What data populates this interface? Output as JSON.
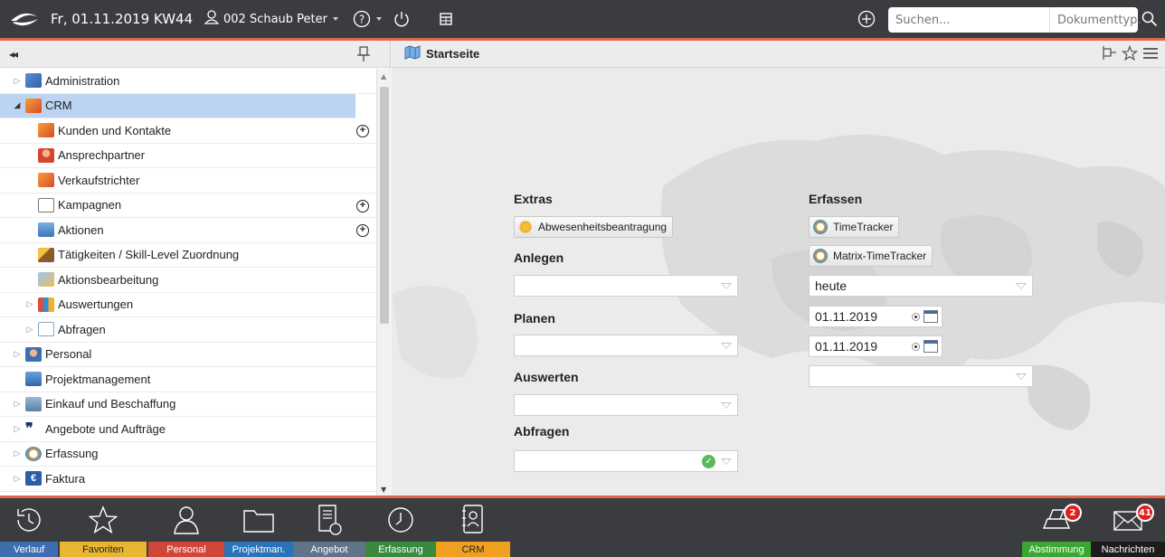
{
  "topbar": {
    "date": "Fr, 01.11.2019 KW44",
    "user": "002 Schaub Peter",
    "search_placeholder": "Suchen...",
    "doc_type": "Dokumenttyp."
  },
  "sidebar": {
    "collapse_label": "◂◂",
    "items": [
      {
        "label": "Administration",
        "icon": "wrench-icon"
      },
      {
        "label": "CRM",
        "icon": "crm-icon"
      },
      {
        "label": "Kunden und Kontakte",
        "icon": "crm-icon"
      },
      {
        "label": "Ansprechpartner",
        "icon": "person-icon"
      },
      {
        "label": "Verkaufstrichter",
        "icon": "crm-icon"
      },
      {
        "label": "Kampagnen",
        "icon": "campaign-icon"
      },
      {
        "label": "Aktionen",
        "icon": "actions-icon"
      },
      {
        "label": "Tätigkeiten / Skill-Level Zuordnung",
        "icon": "hammer-icon"
      },
      {
        "label": "Aktionsbearbeitung",
        "icon": "edit-icon"
      },
      {
        "label": "Auswertungen",
        "icon": "bar-chart-icon"
      },
      {
        "label": "Abfragen",
        "icon": "table-icon"
      },
      {
        "label": "Personal",
        "icon": "personal-icon"
      },
      {
        "label": "Projektmanagement",
        "icon": "project-icon"
      },
      {
        "label": "Einkauf und Beschaffung",
        "icon": "cart-icon"
      },
      {
        "label": "Angebote und Aufträge",
        "icon": "quote-icon"
      },
      {
        "label": "Erfassung",
        "icon": "clock-icon"
      },
      {
        "label": "Faktura",
        "icon": "euro-icon"
      }
    ],
    "plus": "+"
  },
  "main": {
    "title": "Startseite",
    "extras_label": "Extras",
    "abwesenheit_button": "Abwesenheitsbeantragung",
    "anlegen_label": "Anlegen",
    "planen_label": "Planen",
    "auswerten_label": "Auswerten",
    "abfragen_label": "Abfragen",
    "erfassen_label": "Erfassen",
    "timetracker_button": "TimeTracker",
    "matrix_timetracker_button": "Matrix-TimeTracker",
    "period_value": "heute",
    "date_from": "01.11.2019",
    "date_to": "01.11.2019"
  },
  "dock": {
    "verlauf": "Verlauf",
    "favoriten": "Favoriten",
    "personal": "Personal",
    "projektman": "Projektman.",
    "angebot": "Angebot",
    "erfassung": "Erfassung",
    "crm": "CRM",
    "abstimmung": "Abstimmung",
    "abstimmung_count": "2",
    "nachrichten": "Nachrichten",
    "nachrichten_count": "41"
  },
  "colors": {
    "accent": "#e2674a",
    "bar": "#3a3c40",
    "selected_row": "#bcd4f2",
    "verlauf": "#3d6fb0",
    "favoriten": "#e8b630",
    "personal": "#d0473a",
    "projektman": "#2b73b8",
    "angebot": "#5f7389",
    "erfassung": "#3a8a3e",
    "crm": "#f0a020",
    "abstimmung": "#3aa830",
    "nachrichten": "#1c1c1c"
  }
}
